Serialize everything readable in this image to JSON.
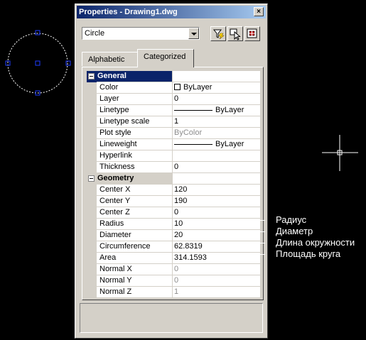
{
  "window": {
    "title": "Properties - Drawing1.dwg",
    "close_glyph": "×"
  },
  "object_combo": {
    "value": "Circle"
  },
  "toolbar": {
    "buttons": [
      {
        "icon": "quick-select-icon"
      },
      {
        "icon": "select-objects-icon"
      },
      {
        "icon": "toggle-pickadd-icon"
      }
    ]
  },
  "tabs": [
    {
      "label": "Alphabetic",
      "active": false
    },
    {
      "label": "Categorized",
      "active": true
    }
  ],
  "properties": {
    "general": {
      "title": "General",
      "rows": [
        {
          "name": "Color",
          "value": "ByLayer",
          "kind": "color"
        },
        {
          "name": "Layer",
          "value": "0"
        },
        {
          "name": "Linetype",
          "value": "ByLayer",
          "kind": "line"
        },
        {
          "name": "Linetype scale",
          "value": "1"
        },
        {
          "name": "Plot style",
          "value": "ByColor",
          "disabled": true
        },
        {
          "name": "Lineweight",
          "value": "ByLayer",
          "kind": "line"
        },
        {
          "name": "Hyperlink",
          "value": ""
        },
        {
          "name": "Thickness",
          "value": "0"
        }
      ]
    },
    "geometry": {
      "title": "Geometry",
      "rows": [
        {
          "name": "Center X",
          "value": "120"
        },
        {
          "name": "Center Y",
          "value": "190"
        },
        {
          "name": "Center Z",
          "value": "0"
        },
        {
          "name": "Radius",
          "value": "10"
        },
        {
          "name": "Diameter",
          "value": "20"
        },
        {
          "name": "Circumference",
          "value": "62.8319"
        },
        {
          "name": "Area",
          "value": "314.1593"
        },
        {
          "name": "Normal X",
          "value": "0",
          "disabled": true
        },
        {
          "name": "Normal Y",
          "value": "0",
          "disabled": true
        },
        {
          "name": "Normal Z",
          "value": "1",
          "disabled": true
        }
      ]
    }
  },
  "annotations": [
    {
      "label": "Радиус"
    },
    {
      "label": "Диаметр"
    },
    {
      "label": "Длина окружности"
    },
    {
      "label": "Площадь круга"
    }
  ],
  "colors": {
    "background": "#000000",
    "selection": "#0a246a",
    "window_face": "#d4d0c8",
    "disabled_text": "#8c8c8c"
  }
}
